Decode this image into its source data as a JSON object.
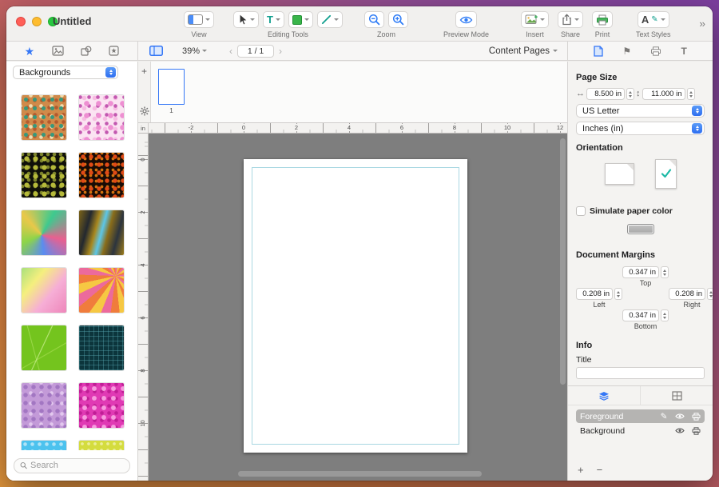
{
  "window": {
    "title": "Untitled"
  },
  "toolbar": {
    "groups": {
      "view": "View",
      "editing_tools": "Editing Tools",
      "zoom": "Zoom",
      "preview_mode": "Preview Mode",
      "insert": "Insert",
      "share": "Share",
      "print": "Print",
      "text_styles": "Text Styles"
    }
  },
  "sidebar": {
    "collection": "Backgrounds",
    "search_placeholder": "Search",
    "thumbnails": [
      "background-color:#d08a4a;background-image:radial-gradient(#37987c 2.2px,transparent 2.8px),radial-gradient(#f1ddb0 2px,transparent 2.6px),radial-gradient(#b45a2e 2px,transparent 2.6px);background-size:11px 11px,13px 13px,9px 9px;background-position:0 0,5px 7px,3px 2px",
      "background-color:#fbe4f2;background-image:radial-gradient(#ee8fd2 3px,transparent 3.6px),radial-gradient(#c258b0 2px,transparent 2.6px),radial-gradient(#f7bce2 2.5px,transparent 3px);background-size:15px 15px,11px 11px,13px 13px;background-position:2px 3px,7px 8px,0 10px",
      "background-color:#10100a;background-image:radial-gradient(#b6ba3a 2.8px,transparent 3.4px),radial-gradient(#7d842c 2px,transparent 2.6px);background-size:11px 11px,8px 8px;background-position:1px 2px,5px 6px",
      "background-color:#190b05;background-image:radial-gradient(#e04a16 2.4px,transparent 3px),radial-gradient(#d4720f 1.6px,transparent 2.2px);background-size:10px 10px,7px 7px;background-position:0 0,4px 4px",
      "background:conic-gradient(from 30deg at 45% 55%,#3ec98f,#e9608f,#5a8cf0,#8cd44a,#e9c84a,#3ec98f)",
      "background:linear-gradient(105deg,#7c6418 0%,#23282f 22%,#a8871e 38%,#5cc6e8 50%,#8a6d1a 62%,#2c343e 80%,#9c7c1c 100%)",
      "background:linear-gradient(130deg,#a8e07c 0%,#f5ef7e 30%,#f6aed6 62%,#ee86ba 100%)",
      "background:repeating-conic-gradient(from 160deg at 82% 18%,#f6c843 0deg 14deg,#f07c3c 14deg 28deg,#ec6a9c 28deg 42deg)",
      "background-color:#74c41e;background-image:linear-gradient(115deg,transparent 46%,#c6ec8a 47%,transparent 48.5%),linear-gradient(75deg,transparent 30%,#a2dc52 31%,transparent 32.5%),linear-gradient(150deg,transparent 60%,#9cd846 61%,transparent 62.5%)",
      "background-color:#0c353c;background-image:repeating-linear-gradient(0deg,rgba(86,168,178,0.4) 0 1px,transparent 1px 6px),repeating-linear-gradient(90deg,rgba(86,168,178,0.4) 0 1px,transparent 1px 6px)",
      "background-color:#c39ad8;background-image:radial-gradient(#a276c2 2.4px,transparent 3px),radial-gradient(#e2c8ee 2px,transparent 2.6px);background-size:10px 10px,13px 13px;background-position:0 0,5px 6px",
      "background-color:#e03ab4;background-image:radial-gradient(#f79ade 2.6px,transparent 3.2px),radial-gradient(#c01e96 2px,transparent 2.6px);background-size:12px 12px,9px 9px;background-position:1px 1px,6px 6px",
      "background-color:#4cc2ee;background-image:radial-gradient(rgba(255,255,255,0.55) 2px,transparent 2.6px);background-size:9px 9px",
      "background-color:#d4dc3e;background-image:radial-gradient(rgba(250,250,210,0.6) 1.6px,transparent 2.2px);background-size:8px 8px"
    ]
  },
  "canvas": {
    "pages_strip": {
      "page_label": "1"
    },
    "zoom_level": "39%",
    "page_indicator": "1 / 1",
    "content_pages_label": "Content Pages",
    "ruler_unit": "in",
    "ruler_h": [
      "-2",
      "0",
      "2",
      "4",
      "6",
      "8",
      "10",
      "12"
    ],
    "ruler_v": [
      "0",
      "2",
      "4",
      "6",
      "8",
      "10"
    ]
  },
  "inspector": {
    "page_size": {
      "heading": "Page Size",
      "width": "8.500 in",
      "height": "11.000 in",
      "preset": "US Letter",
      "units": "Inches (in)"
    },
    "orientation": {
      "heading": "Orientation"
    },
    "simulate_paper_color_label": "Simulate paper color",
    "margins": {
      "heading": "Document Margins",
      "top": "0.347 in",
      "left": "0.208 in",
      "right": "0.208 in",
      "bottom": "0.347 in",
      "top_label": "Top",
      "left_label": "Left",
      "right_label": "Right",
      "bottom_label": "Bottom"
    },
    "info": {
      "heading": "Info",
      "title_label": "Title",
      "title_value": ""
    },
    "layers": {
      "foreground": "Foreground",
      "background": "Background"
    }
  },
  "icons": {
    "star": "★",
    "overflow": "››",
    "prev": "‹",
    "next": "›",
    "plus": "+",
    "minus": "−",
    "pencil": "✎",
    "letter_t": "T",
    "letter_a": "A",
    "h_arrows": "↔",
    "v_arrows": "↕",
    "flag": "⚑",
    "strip_plus": "+"
  },
  "colors": {
    "accent_blue": "#3577f6",
    "accent_teal": "#1db9a6",
    "canvas_gray": "#7e7e7e"
  }
}
